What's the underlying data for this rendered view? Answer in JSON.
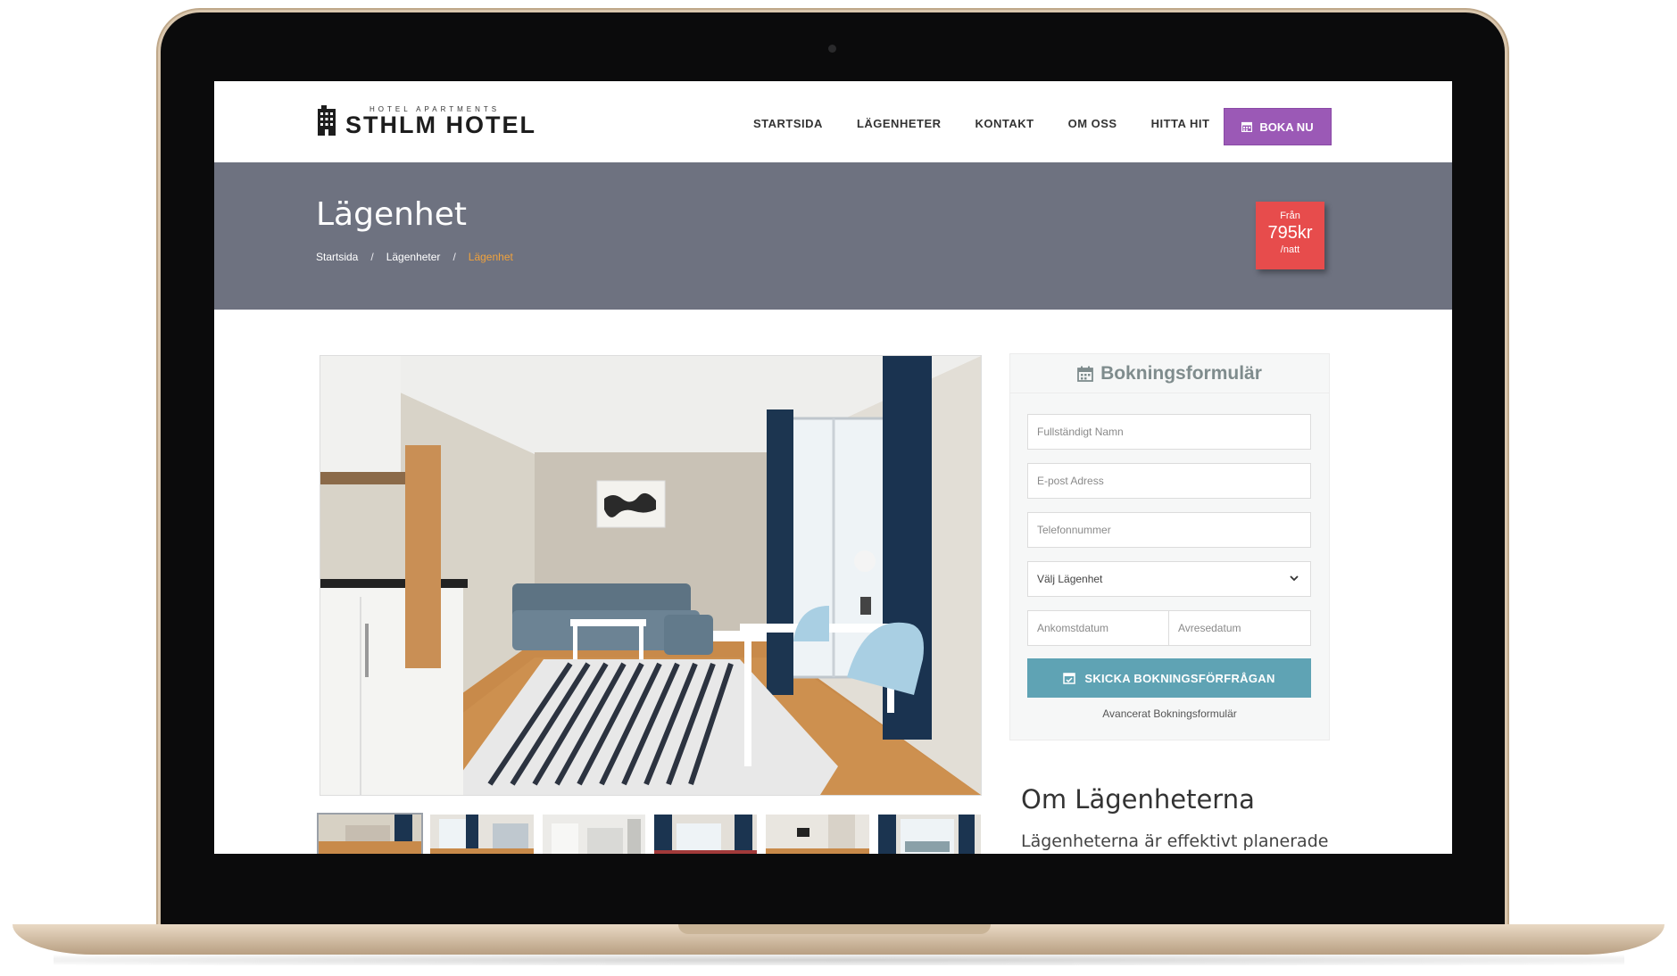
{
  "header": {
    "logo_tagline": "HOTEL APARTMENTS",
    "logo_name": "STHLM HOTEL",
    "nav": [
      "STARTSIDA",
      "LÄGENHETER",
      "KONTAKT",
      "OM OSS",
      "HITTA HIT"
    ],
    "book_button": "BOKA NU"
  },
  "hero": {
    "title": "Lägenhet",
    "breadcrumb": [
      "Startsida",
      "Lägenheter",
      "Lägenhet"
    ],
    "breadcrumb_separator": "/",
    "price": {
      "from": "Från",
      "amount": "795kr",
      "unit": "/natt"
    }
  },
  "booking": {
    "title": "Bokningsformulär",
    "name_placeholder": "Fullständigt Namn",
    "email_placeholder": "E-post Adress",
    "phone_placeholder": "Telefonnummer",
    "apartment_select": "Välj Lägenhet",
    "arrival_placeholder": "Ankomstdatum",
    "departure_placeholder": "Avresedatum",
    "submit_label": "SKICKA BOKNINGSFÖRFRÅGAN",
    "advanced_link": "Avancerat Bokningsformulär"
  },
  "about": {
    "title": "Om Lägenheterna",
    "text": "Lägenheterna är effektivt planerade"
  },
  "colors": {
    "accent_purple": "#9b59b6",
    "hero_bg": "#6e7280",
    "price_red": "#e74c4c",
    "breadcrumb_active": "#f0a23c",
    "submit_teal": "#5fa3b4"
  }
}
